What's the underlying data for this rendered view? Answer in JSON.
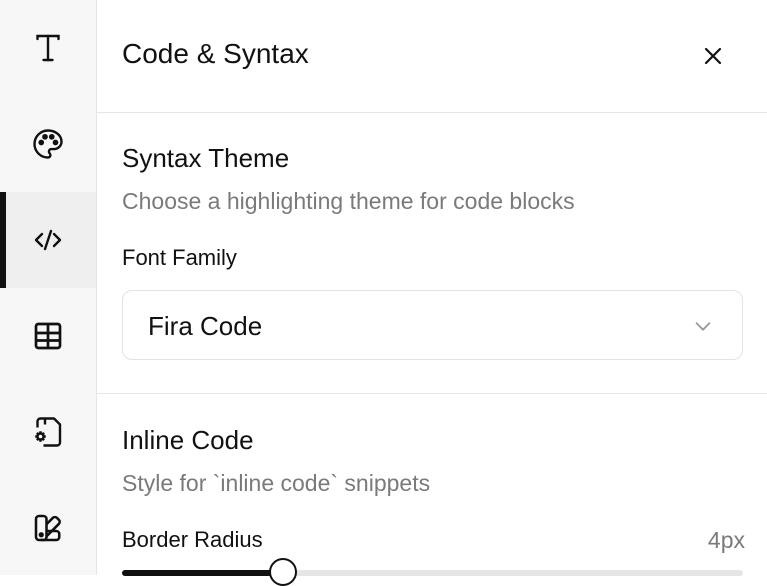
{
  "sidebar": {
    "items": [
      {
        "name": "text",
        "icon": "text-icon"
      },
      {
        "name": "palette",
        "icon": "palette-icon"
      },
      {
        "name": "code",
        "icon": "code-icon",
        "active": true
      },
      {
        "name": "table",
        "icon": "table-icon"
      },
      {
        "name": "file-settings",
        "icon": "file-settings-icon"
      },
      {
        "name": "swatch-book",
        "icon": "swatch-book-icon"
      }
    ]
  },
  "header": {
    "title": "Code & Syntax",
    "close_icon": "close-icon"
  },
  "syntax_section": {
    "heading": "Syntax Theme",
    "description": "Choose a highlighting theme for code blocks",
    "font_family_label": "Font Family",
    "font_family_value": "Fira Code",
    "chevron_icon": "chevron-down-icon"
  },
  "inline_section": {
    "heading": "Inline Code",
    "description": "Style for `inline code` snippets",
    "border_radius_label": "Border Radius",
    "border_radius_value": "4px",
    "border_radius_slider_fraction": 0.26
  },
  "colors": {
    "accent": "#111111",
    "muted_text": "#7a7a7a",
    "border": "#e6e6e6",
    "rail_background": "#f7f7f7"
  }
}
